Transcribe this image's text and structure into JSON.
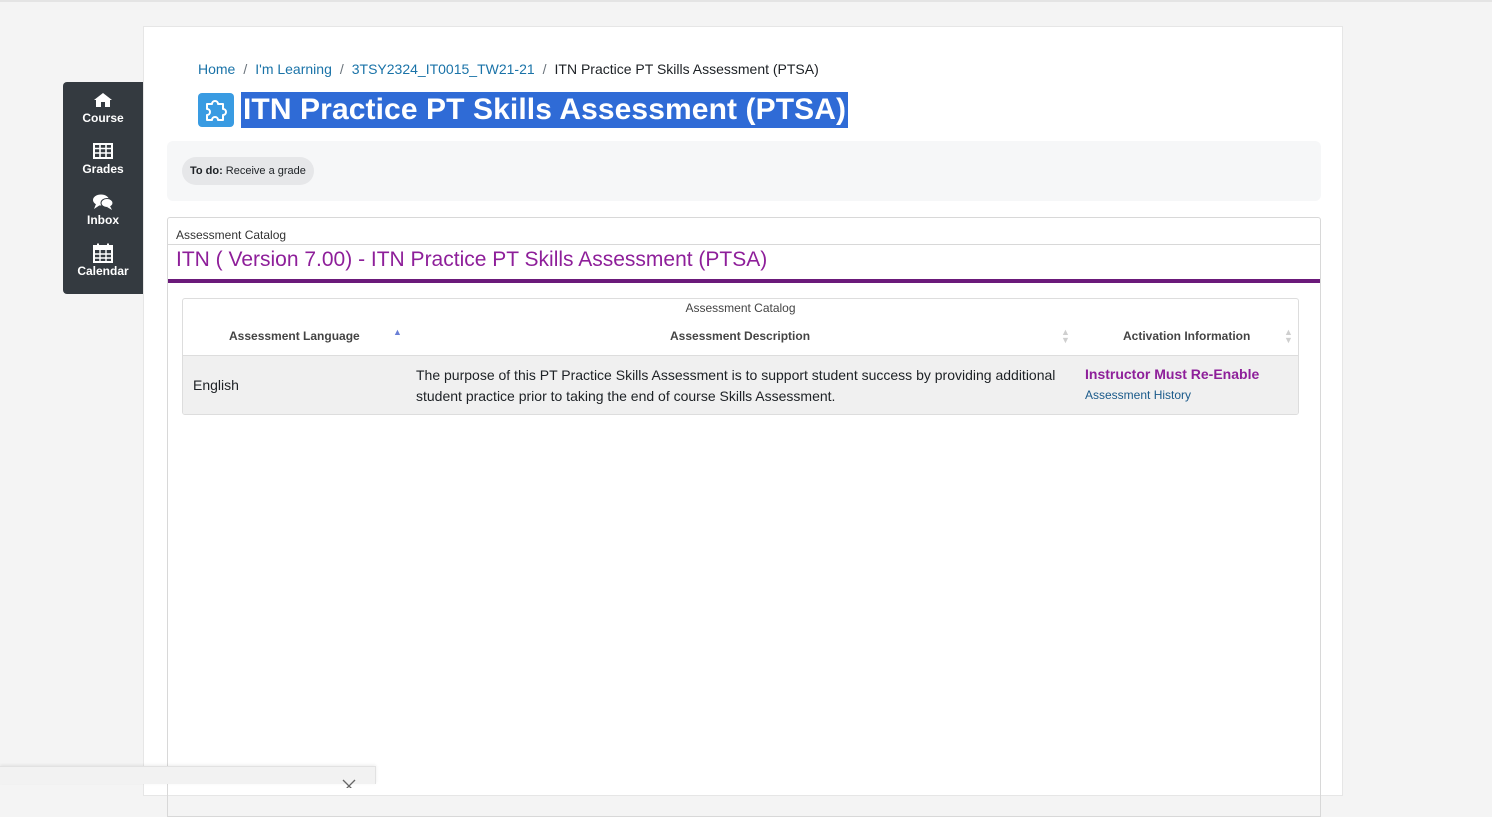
{
  "quicknav": {
    "items": [
      {
        "label": "Course",
        "icon": "home-icon"
      },
      {
        "label": "Grades",
        "icon": "table-icon"
      },
      {
        "label": "Inbox",
        "icon": "comments-icon"
      },
      {
        "label": "Calendar",
        "icon": "calendar-icon"
      }
    ]
  },
  "breadcrumb": {
    "items": [
      "Home",
      "I'm Learning",
      "3TSY2324_IT0015_TW21-21"
    ],
    "current": "ITN Practice PT Skills Assessment (PTSA)",
    "separator": "/"
  },
  "page": {
    "title": "ITN Practice PT Skills Assessment (PTSA)",
    "icon": "puzzle-icon"
  },
  "todo": {
    "label": "To do:",
    "text": "Receive a grade"
  },
  "catalog": {
    "frame_label": "Assessment Catalog",
    "heading": "ITN ( Version 7.00) - ITN Practice PT Skills Assessment (PTSA)",
    "table_caption": "Assessment Catalog",
    "columns": [
      "Assessment Language",
      "Assessment Description",
      "Activation Information"
    ],
    "rows": [
      {
        "language": "English",
        "description": "The purpose of this PT Practice Skills Assessment is to support student success by providing additional student practice prior to taking the end of course Skills Assessment.",
        "activation_status": "Instructor Must Re-Enable",
        "history_link": "Assessment History"
      }
    ]
  },
  "colors": {
    "accent_purple": "#8e1f9a",
    "title_highlight": "#2f6bd6",
    "nav_bg": "#343a40",
    "link": "#1a73a8"
  }
}
